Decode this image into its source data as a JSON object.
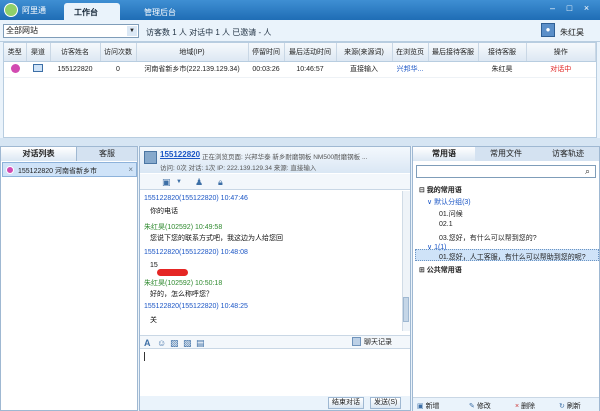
{
  "app": {
    "title": "阿里通"
  },
  "top_tabs": {
    "workbench": "工作台",
    "admin": "管理后台"
  },
  "window_buttons": {
    "minimize": "–",
    "maximize": "□",
    "close": "×"
  },
  "toolbar": {
    "site_select": "全部网站",
    "stats": "访客数 1 人   对话中 1 人   已邀请 - 人",
    "user": "朱红昊"
  },
  "visitor_table": {
    "columns": [
      "类型",
      "渠道",
      "访客姓名",
      "访问次数",
      "地域(IP)",
      "停留时间",
      "最后活动时间",
      "来源(来源词)",
      "在浏览页",
      "最后接待客服",
      "接待客服",
      "操作"
    ],
    "rows": [
      [
        "",
        "",
        "155122820",
        "0",
        "河南省新乡市(222.139.129.34)",
        "00:03:26",
        "10:46:57",
        "直接输入",
        "兴邦华...",
        "",
        "朱红昊",
        "对话中"
      ]
    ]
  },
  "left_panel": {
    "tab_chat": "对话列表",
    "tab_customer": "客服",
    "item": "155122820 河南省新乡市"
  },
  "chat_header": {
    "name": "155122820",
    "browse": "正在浏览页面: 兴邦华泰  新乡耐磨钢板  NM500耐磨钢板 ...",
    "info": "访问: 0次 对话: 1次 IP: 222.139.129.34 来源: 直接输入"
  },
  "messages": [
    {
      "meta": "155122820(155122820)  10:47:46",
      "text": "你的电话",
      "who": "visitor"
    },
    {
      "meta": "朱红昊(102592)  10:49:58",
      "text": "您说下您的联系方式吧，我这边为人给您回",
      "who": "agent"
    },
    {
      "meta": "155122820(155122820)  10:48:08",
      "text": "15",
      "who": "visitor"
    },
    {
      "meta": "朱红昊(102592)  10:50:18",
      "text": "好的，怎么称呼您？",
      "who": "agent"
    },
    {
      "meta": "155122820(155122820)  10:48:25",
      "text": "关",
      "who": "visitor"
    }
  ],
  "chat_input": {
    "history_label": "聊天记录"
  },
  "chat_footer": {
    "end_chat": "结束对话",
    "send": "发送(S)"
  },
  "right_panel": {
    "tab_phrases": "常用语",
    "tab_files": "常用文件",
    "tab_track": "访客轨迹",
    "tree": [
      "⊟ 我的常用语",
      "∨ 默认分组(3)",
      "01.问候",
      "02.1",
      "03.您好，有什么可以帮到您的?",
      "∨ 1(1)",
      "01.您好，人工客服，有什么可以帮助到您的呢?",
      "⊞ 公共常用语"
    ],
    "footer": {
      "add": "新增",
      "edit": "修改",
      "delete": "删除",
      "refresh": "刷新"
    }
  }
}
